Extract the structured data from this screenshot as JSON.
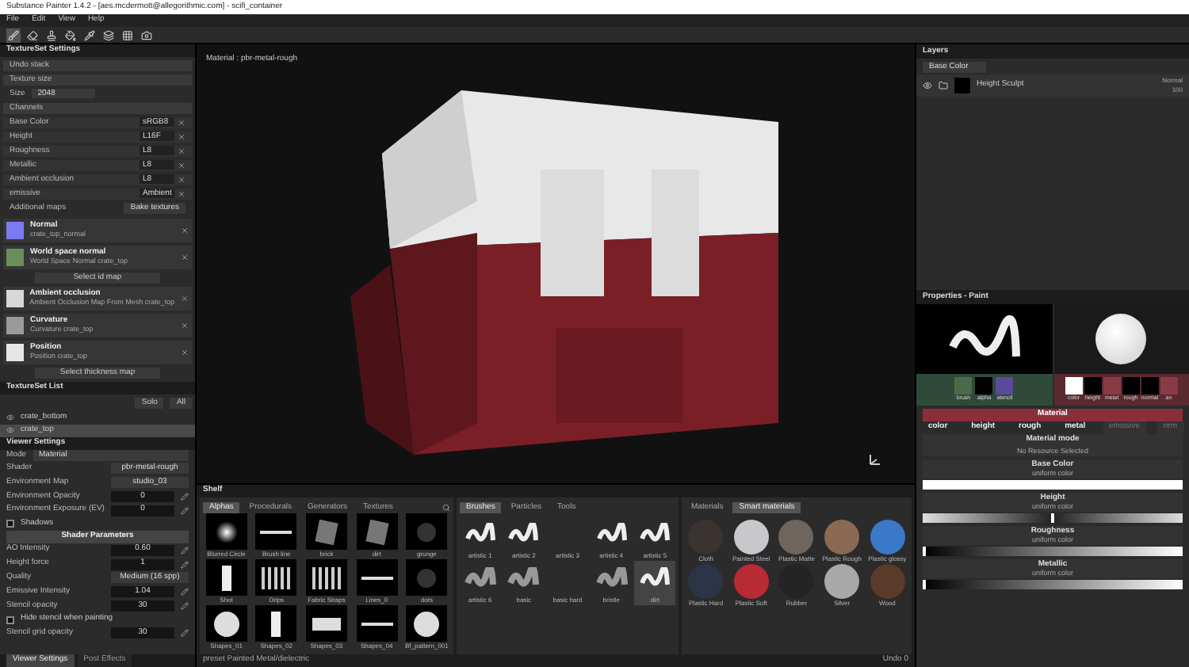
{
  "window": {
    "title": "Substance Painter 1.4.2 - [aes.mcdermott@allegorithmic.com] - scifi_container"
  },
  "menu": [
    "File",
    "Edit",
    "View",
    "Help"
  ],
  "toolbar": [
    {
      "kind": "brush",
      "selected": true
    },
    {
      "kind": "eraser",
      "selected": false
    },
    {
      "kind": "projection",
      "selected": false
    },
    {
      "kind": "fill",
      "selected": false
    },
    {
      "kind": "picker",
      "selected": false
    },
    {
      "kind": "layers",
      "selected": false
    },
    {
      "kind": "grid",
      "selected": false
    },
    {
      "kind": "camera",
      "selected": false
    }
  ],
  "texture_set_settings": {
    "title": "TextureSet Settings",
    "undo": "Undo stack",
    "texture_size": "Texture size",
    "size_label": "Size",
    "size_value": "2048",
    "channels_label": "Channels",
    "channels": [
      {
        "name": "Base Color",
        "format": "sRGB8"
      },
      {
        "name": "Height",
        "format": "L16F"
      },
      {
        "name": "Roughness",
        "format": "L8"
      },
      {
        "name": "Metallic",
        "format": "L8"
      },
      {
        "name": "Ambient occlusion",
        "format": "L8"
      },
      {
        "name": "emissive",
        "format": "Ambient"
      }
    ],
    "additional_label": "Additional maps",
    "bake_button": "Bake textures",
    "maps": [
      {
        "kind": "map",
        "title": "Normal",
        "file": "crate_top_normal",
        "color": "#7b7bf0"
      },
      {
        "kind": "map",
        "title": "World space normal",
        "file": "World Space Normal crate_top",
        "color": "#6a8f5a"
      },
      {
        "kind": "button",
        "label": "Select id map"
      },
      {
        "kind": "map",
        "title": "Ambient occlusion",
        "file": "Ambient Occlusion Map From Mesh crate_top",
        "color": "#d8d8d8"
      },
      {
        "kind": "map",
        "title": "Curvature",
        "file": "Curvature crate_top",
        "color": "#9a9a9a"
      },
      {
        "kind": "map",
        "title": "Position",
        "file": "Position crate_top",
        "color": "#e6e6e6"
      },
      {
        "kind": "button",
        "label": "Select thickness map"
      }
    ]
  },
  "texture_set_list": {
    "title": "TextureSet List",
    "buttons": [
      "Solo",
      "All"
    ],
    "items": [
      {
        "name": "crate_bottom",
        "selected": false
      },
      {
        "name": "crate_top",
        "selected": true
      }
    ]
  },
  "viewer_settings": {
    "title": "Viewer Settings",
    "mode_label": "Mode",
    "mode": "Material",
    "rows": [
      {
        "kind": "select",
        "label": "Shader",
        "value": "pbr-metal-rough"
      },
      {
        "kind": "select",
        "label": "Environment Map",
        "value": "studio_03"
      },
      {
        "kind": "number",
        "label": "Environment Opacity",
        "value": "0"
      },
      {
        "kind": "number",
        "label": "Environment Exposure (EV)",
        "value": "0"
      },
      {
        "kind": "check",
        "label": "Shadows",
        "checked": false
      }
    ],
    "shader_title": "Shader Parameters",
    "params": [
      {
        "kind": "number",
        "label": "AO Intensity",
        "value": "0.60"
      },
      {
        "kind": "number",
        "label": "Height force",
        "value": "1"
      },
      {
        "kind": "select",
        "label": "Quality",
        "value": "Medium (16 spp)"
      },
      {
        "kind": "number",
        "label": "Emissive Intensity",
        "value": "1.04"
      }
    ],
    "stencil": [
      {
        "kind": "number",
        "label": "Stencil opacity",
        "value": "30"
      },
      {
        "kind": "check",
        "label": "Hide stencil when painting",
        "checked": false
      },
      {
        "kind": "number",
        "label": "Stencil grid opacity",
        "value": "30"
      }
    ]
  },
  "bottom_tabs": [
    {
      "label": "Viewer Settings",
      "selected": true
    },
    {
      "label": "Post Effects",
      "selected": false
    }
  ],
  "viewport": {
    "label": "Material : pbr-metal-rough"
  },
  "shelf": {
    "title": "Shelf",
    "alphas": {
      "tabs": [
        {
          "label": "Alphas",
          "selected": true
        },
        {
          "label": "Procedurals",
          "selected": false
        },
        {
          "label": "Generators",
          "selected": false
        },
        {
          "label": "Textures",
          "selected": false
        }
      ],
      "items": [
        {
          "kind": "blob",
          "name": "Blurred Circle"
        },
        {
          "kind": "line",
          "name": "Brush line"
        },
        {
          "kind": "noise",
          "name": "brick"
        },
        {
          "kind": "noise",
          "name": "dirt"
        },
        {
          "kind": "faint",
          "name": "grunge"
        },
        {
          "kind": "bar",
          "name": "Shot"
        },
        {
          "kind": "stripes",
          "name": "Drips"
        },
        {
          "kind": "stripes",
          "name": "Fabric Straps"
        },
        {
          "kind": "line",
          "name": "Lines_0"
        },
        {
          "kind": "faint",
          "name": "dots"
        },
        {
          "kind": "disc",
          "name": "Shapes_01"
        },
        {
          "kind": "bar",
          "name": "Shapes_02"
        },
        {
          "kind": "rect",
          "name": "Shapes_03"
        },
        {
          "kind": "line",
          "name": "Shapes_04"
        },
        {
          "kind": "disc",
          "name": "Bf_pattern_001"
        }
      ]
    },
    "brushes": {
      "tabs": [
        {
          "label": "Brushes",
          "selected": true
        },
        {
          "label": "Particles",
          "selected": false
        },
        {
          "label": "Tools",
          "selected": false
        }
      ],
      "items": [
        {
          "kind": "stroke",
          "name": "artistic 1",
          "selected": false
        },
        {
          "kind": "stroke",
          "name": "artistic 2",
          "selected": false
        },
        {
          "kind": "empty",
          "name": "artistic 3",
          "selected": false
        },
        {
          "kind": "stroke",
          "name": "artistic 4",
          "selected": false
        },
        {
          "kind": "stroke",
          "name": "artistic 5",
          "selected": false
        },
        {
          "kind": "soft",
          "name": "artistic 6",
          "selected": false
        },
        {
          "kind": "soft",
          "name": "basic",
          "selected": false
        },
        {
          "kind": "empty",
          "name": "basic hard",
          "selected": false
        },
        {
          "kind": "soft",
          "name": "bristle",
          "selected": false
        },
        {
          "kind": "stroke",
          "name": "dirt",
          "selected": true
        }
      ]
    },
    "materials": {
      "tabs": [
        {
          "label": "Materials",
          "selected": false
        },
        {
          "label": "Smart materials",
          "selected": true
        }
      ],
      "items": [
        {
          "name": "Cloth",
          "color": "#3a3330"
        },
        {
          "name": "Painted Steel",
          "color": "#c8c8cc"
        },
        {
          "name": "Plastic Matte",
          "color": "#6e665e"
        },
        {
          "name": "Plastic Rough",
          "color": "#8a6a52"
        },
        {
          "name": "Plastic glossy",
          "color": "#3a78c8"
        },
        {
          "name": "Plastic Hard",
          "color": "#2c3448"
        },
        {
          "name": "Plastic Soft",
          "color": "#b82a34"
        },
        {
          "name": "Rubber",
          "color": "#242424"
        },
        {
          "name": "Silver",
          "color": "#a8a8a8"
        },
        {
          "name": "Wood",
          "color": "#5a3a28"
        }
      ]
    },
    "status": "preset Painted Metal/dielectric",
    "undo": "Undo 0"
  },
  "layers": {
    "title": "Layers",
    "channel": "Base Color",
    "items": [
      {
        "name": "Height Sculpt",
        "blend": "Normal",
        "opacity": "100",
        "visible": true
      }
    ]
  },
  "properties": {
    "title": "Properties - Paint",
    "brush_slots": [
      {
        "label": "brush",
        "color": "#4a6a4a"
      },
      {
        "label": "alpha",
        "color": "#000000"
      },
      {
        "label": "stencil",
        "color": "#5a4a9a"
      }
    ],
    "material_slots": [
      {
        "label": "color",
        "color": "#ffffff"
      },
      {
        "label": "height",
        "color": "#000000"
      },
      {
        "label": "metal",
        "color": "#8a3a44"
      },
      {
        "label": "rough",
        "color": "#000000"
      },
      {
        "label": "normal",
        "color": "#000000"
      },
      {
        "label": "ao",
        "color": "#8a3a44"
      }
    ],
    "material_title": "Material",
    "channels": [
      {
        "label": "color",
        "on": true
      },
      {
        "label": "height",
        "on": true
      },
      {
        "label": "rough",
        "on": true
      },
      {
        "label": "metal",
        "on": true
      },
      {
        "label": "emissive",
        "on": false
      },
      {
        "label": "nrm",
        "on": false
      }
    ],
    "mode_title": "Material mode",
    "mode_value": "No Resource Selected",
    "sections": [
      {
        "kind": "color",
        "title": "Base Color",
        "sub": "uniform color"
      },
      {
        "kind": "slider",
        "title": "Height",
        "sub": "uniform color",
        "level": 0.5
      },
      {
        "kind": "gradient",
        "title": "Roughness",
        "sub": "uniform color",
        "level": 0
      },
      {
        "kind": "gradient",
        "title": "Metallic",
        "sub": "uniform color",
        "level": 0
      }
    ]
  }
}
